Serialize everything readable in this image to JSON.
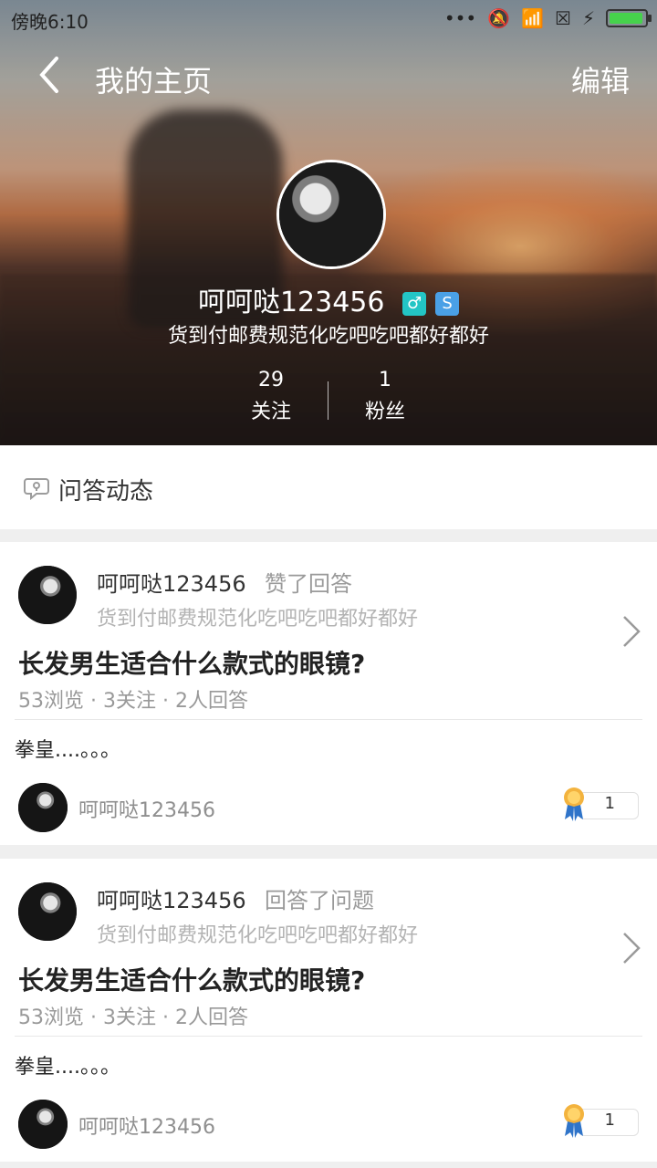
{
  "status": {
    "time": "傍晚6:10",
    "icons": [
      "more-icon",
      "mute-icon",
      "wifi-icon",
      "sim-icon",
      "charge-icon",
      "battery-icon"
    ]
  },
  "header": {
    "title": "我的主页",
    "edit_label": "编辑",
    "username": "呵呵哒123456",
    "bio": "货到付邮费规范化吃吧吃吧都好都好",
    "follow_count": "29",
    "follow_label": "关注",
    "fans_count": "1",
    "fans_label": "粉丝",
    "male_symbol": "♂",
    "blue_badge_symbol": "S"
  },
  "section": {
    "title": "问答动态"
  },
  "feed": [
    {
      "user": "呵呵哒123456",
      "action": "赞了回答",
      "bio": "货到付邮费规范化吃吧吃吧都好都好",
      "question": "长发男生适合什么款式的眼镜?",
      "meta": "53浏览 · 3关注 · 2人回答",
      "answer": "拳皇....。。。",
      "answer_user": "呵呵哒123456",
      "likes": "1"
    },
    {
      "user": "呵呵哒123456",
      "action": "回答了问题",
      "bio": "货到付邮费规范化吃吧吃吧都好都好",
      "question": "长发男生适合什么款式的眼镜?",
      "meta": "53浏览 · 3关注 · 2人回答",
      "answer": "拳皇....。。。",
      "answer_user": "呵呵哒123456",
      "likes": "1"
    }
  ],
  "colors": {
    "accent_green": "#46d24c",
    "male_badge": "#23c5c5",
    "blue_badge": "#4aa0e6"
  }
}
